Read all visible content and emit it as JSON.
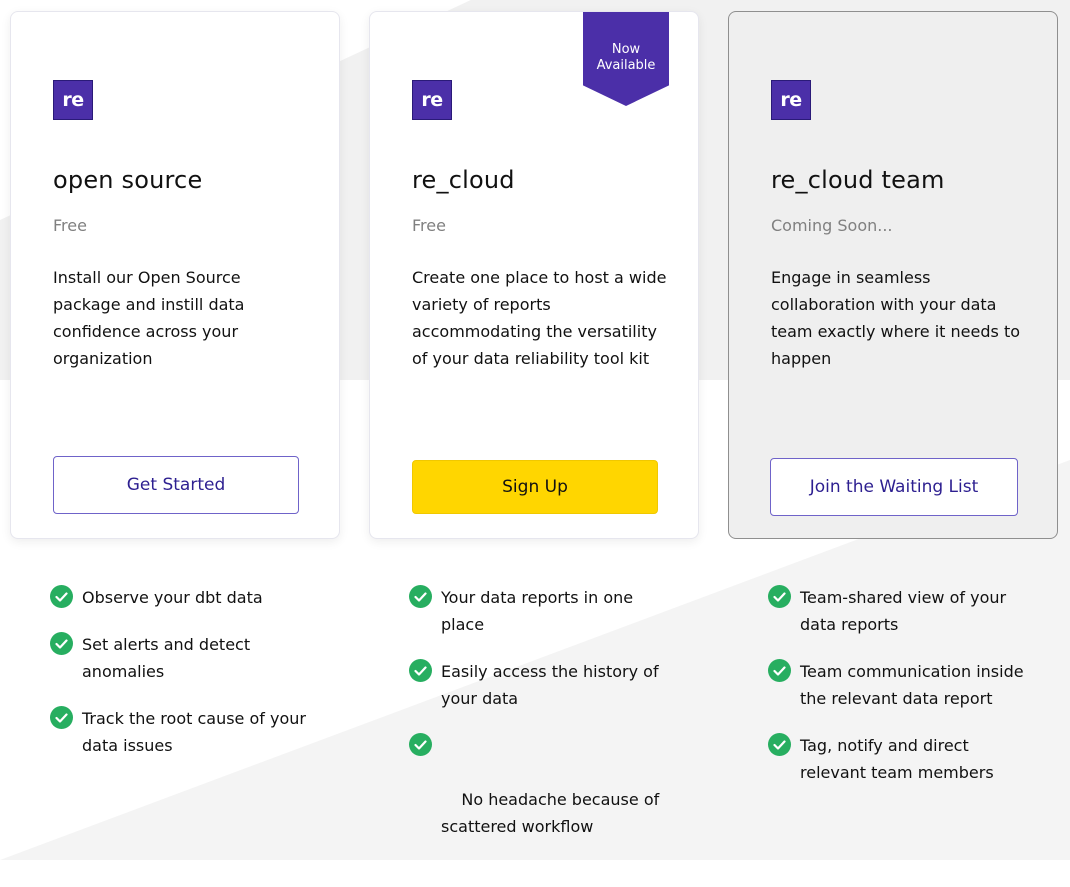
{
  "plans": [
    {
      "logo_text": "re",
      "title": "open source",
      "price": "Free",
      "description": "Install our Open Source package and instill data confidence across your organization",
      "button_label": "Get Started",
      "features": [
        "Observe your dbt data",
        "Set alerts and detect anomalies",
        "Track the root cause of your data issues"
      ]
    },
    {
      "logo_text": "re",
      "ribbon": {
        "line1": "Now",
        "line2": "Available"
      },
      "title": "re_cloud",
      "price": "Free",
      "description": "Create one place to host a wide variety of reports accommodating the versatility of your data reliability tool kit",
      "button_label": "Sign Up",
      "features": [
        "Your data reports in one place",
        "Easily access the history of your data",
        "No headache because of  scattered workflow"
      ]
    },
    {
      "logo_text": "re",
      "title": "re_cloud team",
      "price": "Coming Soon...",
      "description": "Engage in seamless collaboration with your data team exactly where it needs to happen",
      "button_label": "Join the Waiting List",
      "features": [
        "Team-shared view of your data reports",
        "Team communication inside the relevant data report",
        "Tag, notify and direct relevant team members"
      ]
    }
  ],
  "icons": {
    "feature": "check-circle-icon",
    "logo": "re-logo-icon"
  },
  "colors": {
    "brand": "#4b2fa8",
    "signup_button": "#ffd600",
    "check": "#27ae60",
    "price_text": "#808080"
  }
}
